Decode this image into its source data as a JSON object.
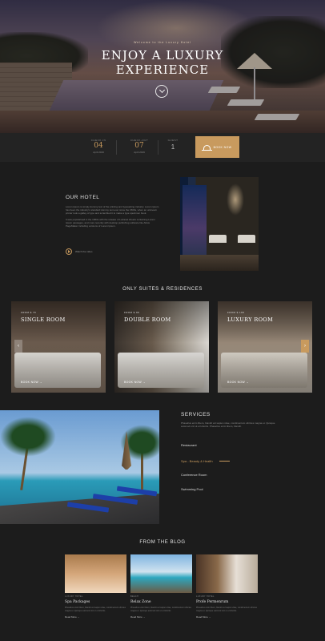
{
  "hero": {
    "eyebrow": "Welcome to the Luxury Hotel",
    "title_line1": "ENJOY A LUXURY",
    "title_line2": "EXPERIENCE"
  },
  "booking": {
    "checkin_label": "CHECK-IN",
    "checkin_day": "04",
    "checkin_month": "April 2019",
    "checkout_label": "CHECK-OUT",
    "checkout_day": "07",
    "checkout_month": "April 2019",
    "guests_label": "GUEST",
    "guests_value": "1",
    "button_label": "BOOK NOW"
  },
  "hotel": {
    "title": "OUR HOTEL",
    "paragraph1": "Lorem ipsum is simply dummy text of the printing and typesetting industry. Lorem ipsum has been the industry's standard dummy text ever since the 1500s, when an unknown printer took a galley of type and scrambled it to make a type specimen book.",
    "paragraph2": "It was popularised in the 1960s with the release of Letraset sheets containing Lorem Ipsum passages, and more recently with desktop publishing software like Aldus PageMaker including versions of Lorem Ipsum.",
    "watch_label": "Watch the video"
  },
  "suites": {
    "title": "ONLY SUITES & RESIDENCES",
    "rooms": [
      {
        "category": "FROM $ 79",
        "name": "SINGLE ROOM",
        "cta": "BOOK NOW →"
      },
      {
        "category": "FROM $ 99",
        "name": "DOUBLE ROOM",
        "cta": "BOOK NOW →"
      },
      {
        "category": "FROM $ 199",
        "name": "LUXURY ROOM",
        "cta": "BOOK NOW →"
      }
    ],
    "prev_icon": "‹",
    "next_icon": "›"
  },
  "services": {
    "title": "SERVICES",
    "text": "Phasellus enim libero, blandit vel sapien vitae, condimentum ultricies magna et. Quisque euismod orci ut et lobortis. Phasellus enim libero, blandit.",
    "items": [
      "Restaurant",
      "Spa - Beauty & Health",
      "Conference Room",
      "Swimming Pool"
    ]
  },
  "blog": {
    "title": "FROM THE BLOG",
    "posts": [
      {
        "category": "LUXURY HOTEL",
        "title": "Spa Packages",
        "excerpt": "Phasellus enim libero, blandit vel sapien vitae, condimentum ultricies magna et. Quisque euismod orci ut et lobortis.",
        "more": "Read More →"
      },
      {
        "category": "BEACH",
        "title": "Relax Zone",
        "excerpt": "Phasellus enim libero, blandit vel sapien vitae, condimentum ultricies magna et. Quisque euismod orci ut et lobortis.",
        "more": "Read More →"
      },
      {
        "category": "LUXURY HOTEL",
        "title": "Profe Permenrum",
        "excerpt": "Phasellus enim libero, blandit vel sapien vitae, condimentum ultricies magna et. Quisque euismod orci ut et lobortis.",
        "more": "Read More →"
      }
    ]
  },
  "colors": {
    "accent": "#c89a5e",
    "background": "#1c1c1c"
  }
}
